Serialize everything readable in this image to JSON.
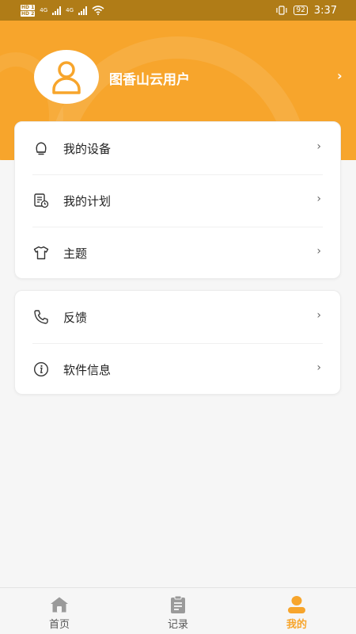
{
  "status_bar": {
    "sim1": "HD 1",
    "sim2": "HD 2",
    "network": "4G",
    "battery": "92",
    "time": "3:37"
  },
  "profile": {
    "username": "图香山云用户",
    "arrow": "›"
  },
  "menu_group1": [
    {
      "label": "我的设备",
      "icon": "device-icon"
    },
    {
      "label": "我的计划",
      "icon": "plan-icon"
    },
    {
      "label": "主题",
      "icon": "shirt-icon"
    }
  ],
  "menu_group2": [
    {
      "label": "反馈",
      "icon": "phone-icon"
    },
    {
      "label": "软件信息",
      "icon": "info-icon"
    }
  ],
  "row_arrow": "›",
  "bottom_nav": {
    "home": "首页",
    "records": "记录",
    "mine": "我的",
    "active": "mine"
  },
  "colors": {
    "accent": "#f7a52c",
    "status_bar": "#b07c17"
  }
}
